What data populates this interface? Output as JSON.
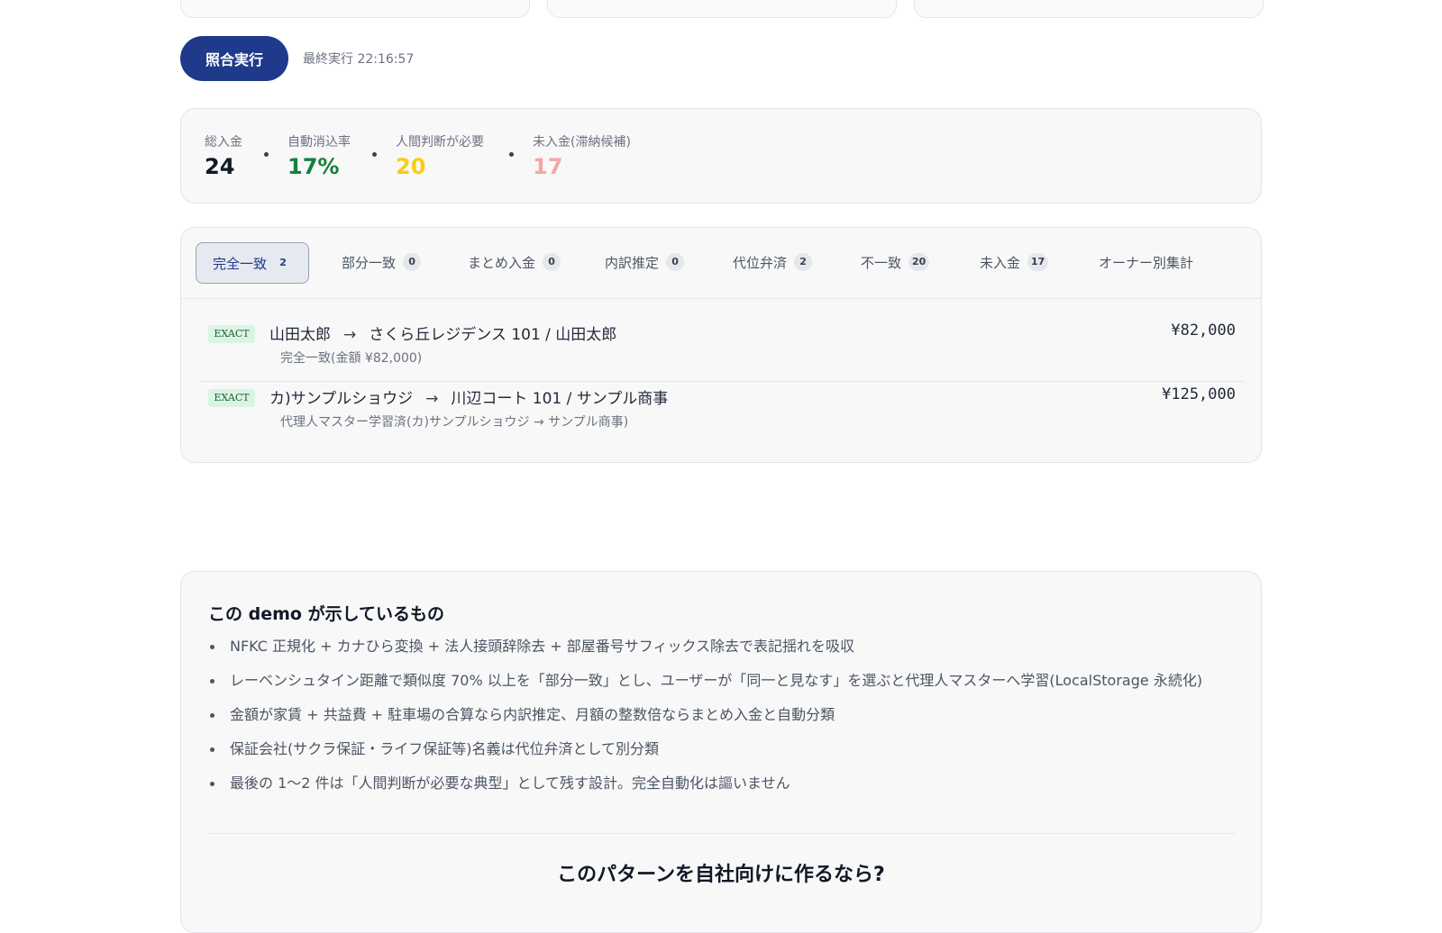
{
  "run": {
    "button_label": "照合実行",
    "last_run": "最終実行 22:16:57"
  },
  "stats": [
    {
      "label": "総入金",
      "value": "24",
      "color": "#111827"
    },
    {
      "label": "自動消込率",
      "value": "17%",
      "color": "#15803d"
    },
    {
      "label": "人間判断が必要",
      "value": "20",
      "color": "#facc15"
    },
    {
      "label": "未入金(滞納候補)",
      "value": "17",
      "color": "#f4a6a6"
    }
  ],
  "tabs": [
    {
      "label": "完全一致",
      "count": "2"
    },
    {
      "label": "部分一致",
      "count": "0"
    },
    {
      "label": "まとめ入金",
      "count": "0"
    },
    {
      "label": "内訳推定",
      "count": "0"
    },
    {
      "label": "代位弁済",
      "count": "2"
    },
    {
      "label": "不一致",
      "count": "20"
    },
    {
      "label": "未入金",
      "count": "17"
    },
    {
      "label": "オーナー別集計"
    }
  ],
  "matches": [
    {
      "badge": "EXACT",
      "payer": "山田太郎",
      "arrow": "→",
      "target": "さくら丘レジデンス 101 / 山田太郎",
      "note": "完全一致(金額 ¥82,000)",
      "amount": "¥82,000"
    },
    {
      "badge": "EXACT",
      "payer": "カ)サンプルショウジ",
      "arrow": "→",
      "target": "川辺コート 101 / サンプル商事",
      "note": "代理人マスター学習済(カ)サンプルショウジ → サンプル商事)",
      "amount": "¥125,000"
    }
  ],
  "about": {
    "title": "この demo が示しているもの",
    "items": [
      "NFKC 正規化 + カナひら変換 + 法人接頭辞除去 + 部屋番号サフィックス除去で表記揺れを吸収",
      "レーベンシュタイン距離で類似度 70% 以上を「部分一致」とし、ユーザーが「同一と見なす」を選ぶと代理人マスターへ学習(LocalStorage 永続化)",
      "金額が家賃 + 共益費 + 駐車場の合算なら内訳推定、月額の整数倍ならまとめ入金と自動分類",
      "保証会社(サクラ保証・ライフ保証等)名義は代位弁済として別分類",
      "最後の 1〜2 件は「人間判断が必要な典型」として残す設計。完全自動化は謳いません"
    ],
    "footer_title": "このパターンを自社向けに作るなら?"
  }
}
